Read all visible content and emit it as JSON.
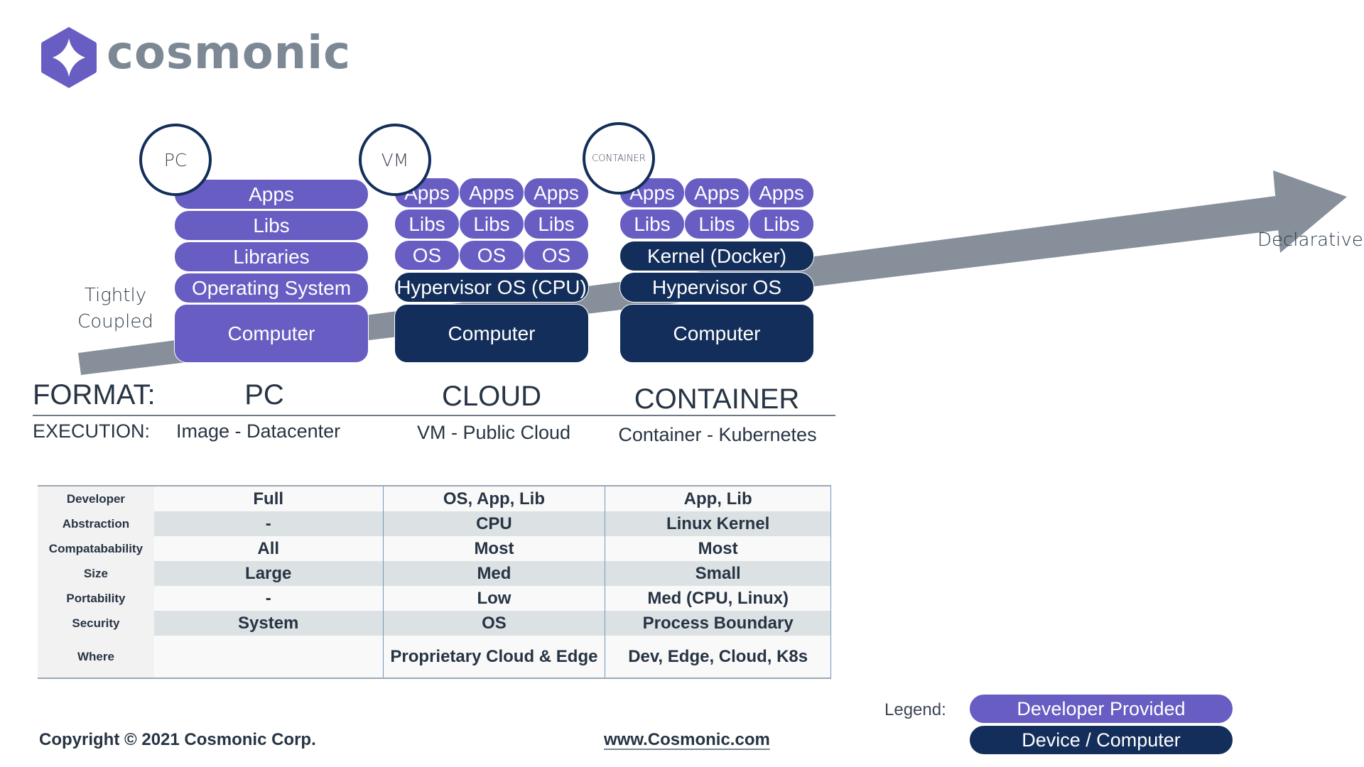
{
  "brand": {
    "name": "cosmonic",
    "primary_color": "#675dc2",
    "dark_color": "#132e5a",
    "text_color": "#7c8894"
  },
  "axis": {
    "start_label_line1": "Tightly",
    "start_label_line2": "Coupled",
    "end_label": "Declarative",
    "arrow_color": "#87909a"
  },
  "stacks": {
    "pc": {
      "badge": "PC",
      "layers": [
        "Apps",
        "Libs",
        "Libraries",
        "Operating System",
        "Computer"
      ]
    },
    "vm": {
      "badge": "VM",
      "apps": [
        "Apps",
        "Apps",
        "Apps"
      ],
      "libs": [
        "Libs",
        "Libs",
        "Libs"
      ],
      "os": [
        "OS",
        "OS",
        "OS"
      ],
      "hypervisor": "Hypervisor OS (CPU)",
      "computer": "Computer"
    },
    "container": {
      "badge": "CONTAINER",
      "apps": [
        "Apps",
        "Apps",
        "Apps"
      ],
      "libs": [
        "Libs",
        "Libs",
        "Libs"
      ],
      "kernel": "Kernel (Docker)",
      "hypervisor": "Hypervisor OS",
      "computer": "Computer"
    }
  },
  "format": {
    "label": "FORMAT:",
    "values": [
      "PC",
      "CLOUD",
      "CONTAINER"
    ]
  },
  "execution": {
    "label": "EXECUTION:",
    "values": [
      "Image - Datacenter",
      "VM - Public Cloud",
      "Container - Kubernetes"
    ]
  },
  "table": {
    "rows": [
      {
        "label": "Developer",
        "values": [
          "Full",
          "OS, App, Lib",
          "App, Lib"
        ]
      },
      {
        "label": "Abstraction",
        "values": [
          "-",
          "CPU",
          "Linux Kernel"
        ]
      },
      {
        "label": "Compatabability",
        "values": [
          "All",
          "Most",
          "Most"
        ]
      },
      {
        "label": "Size",
        "values": [
          "Large",
          "Med",
          "Small"
        ]
      },
      {
        "label": "Portability",
        "values": [
          "-",
          "Low",
          "Med (CPU, Linux)"
        ]
      },
      {
        "label": "Security",
        "values": [
          "System",
          "OS",
          "Process Boundary"
        ]
      },
      {
        "label": "Where",
        "values": [
          "",
          "Proprietary Cloud & Edge",
          "Dev, Edge, Cloud, K8s"
        ]
      }
    ]
  },
  "legend": {
    "label": "Legend:",
    "items": [
      {
        "label": "Developer Provided",
        "color": "#675dc2"
      },
      {
        "label": "Device / Computer",
        "color": "#132e5a"
      }
    ]
  },
  "footer": {
    "copyright": "Copyright © 2021 Cosmonic Corp.",
    "website": "www.Cosmonic.com"
  }
}
